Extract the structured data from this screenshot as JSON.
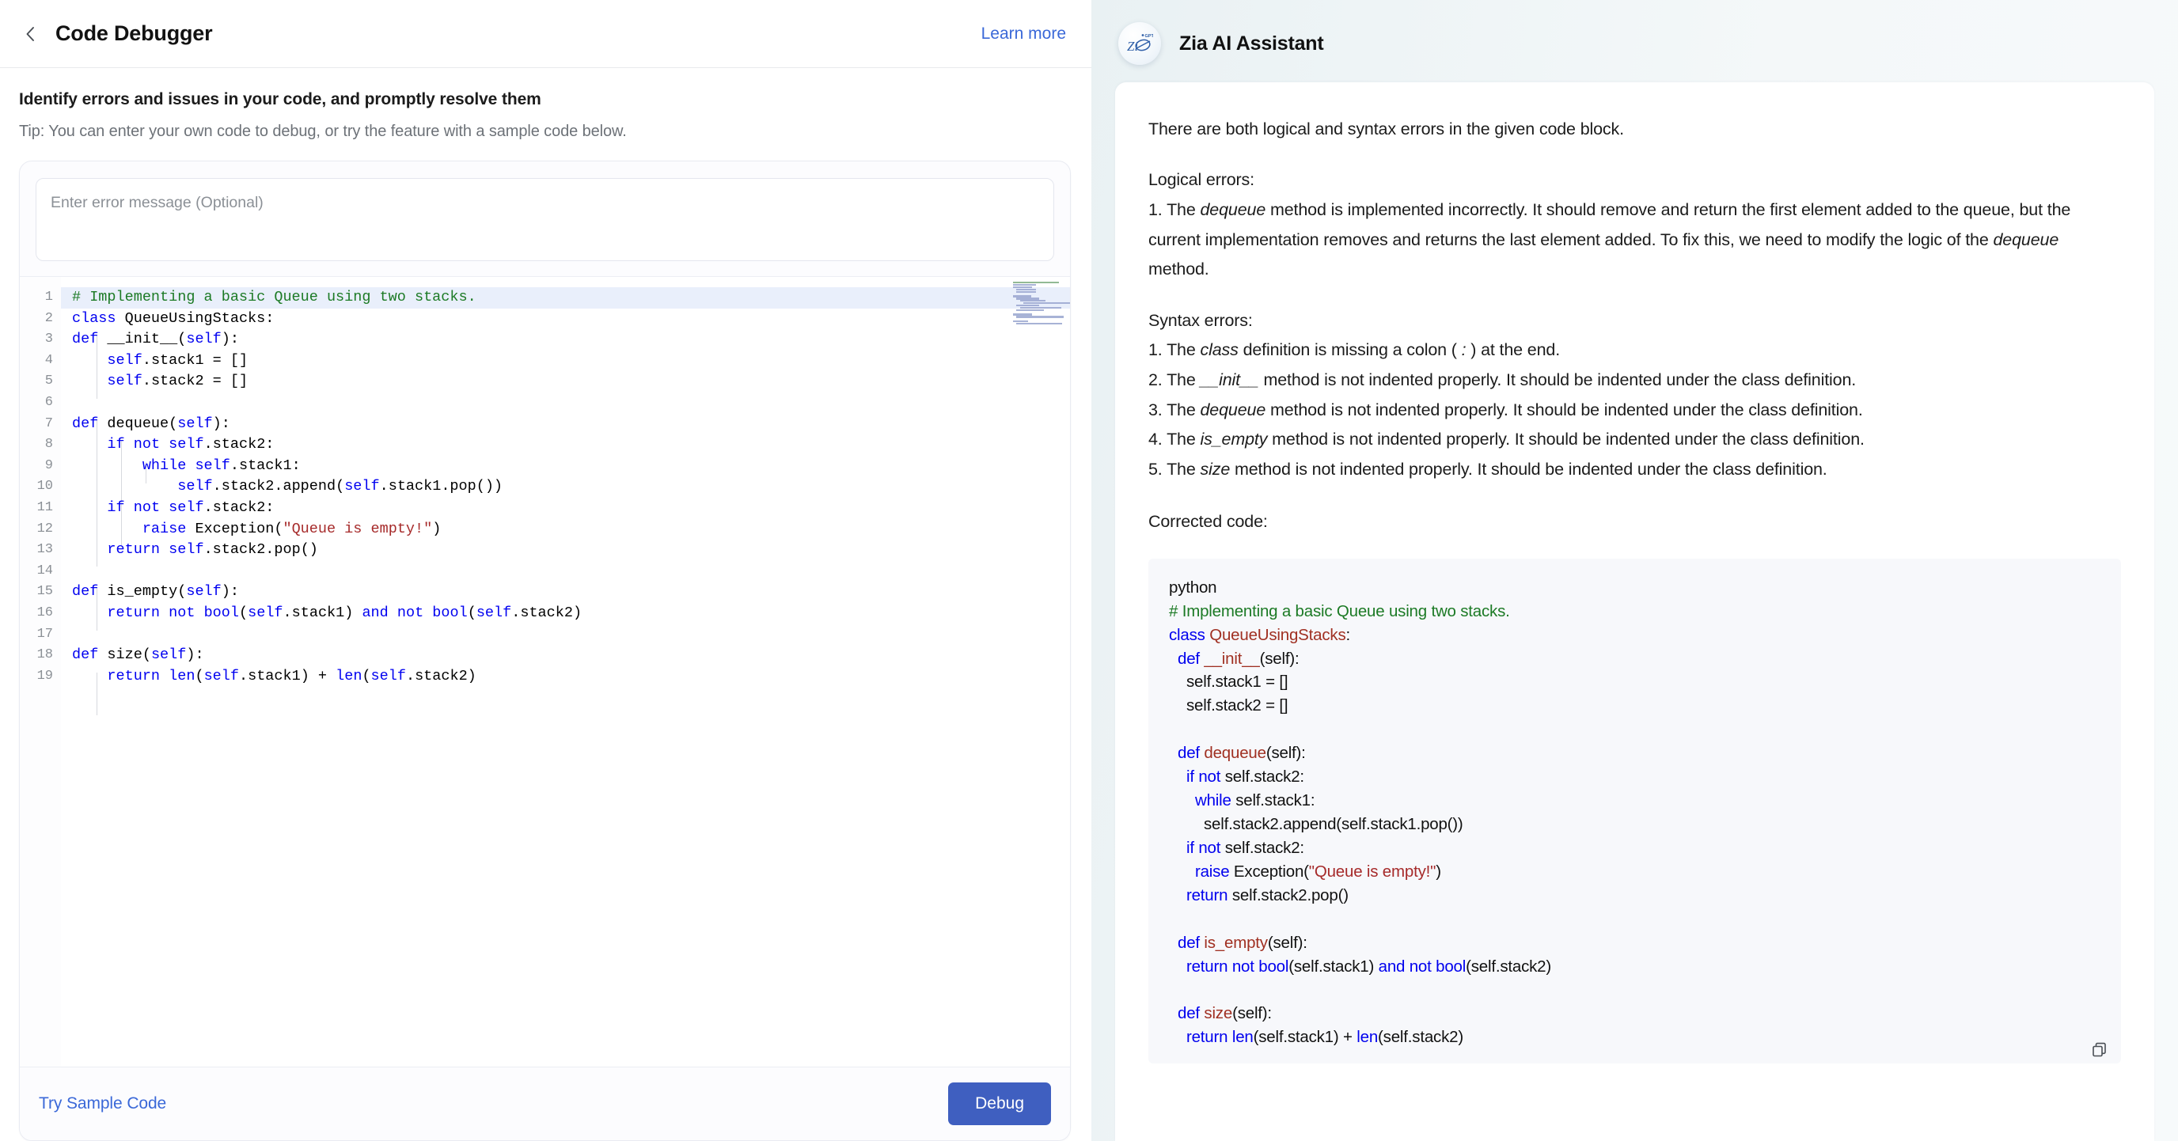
{
  "header": {
    "back_icon": "chevron-left-icon",
    "title": "Code Debugger",
    "learn_more": "Learn more"
  },
  "intro": {
    "title": "Identify errors and issues in your code, and promptly resolve them",
    "tip": "Tip: You can enter your own code to debug, or try the feature with a sample code below."
  },
  "error_input": {
    "placeholder": "Enter error message (Optional)",
    "value": ""
  },
  "footer": {
    "try_sample": "Try Sample Code",
    "debug": "Debug"
  },
  "colors": {
    "accent_blue": "#3a68d8",
    "debug_button": "#3f5fc0",
    "comment_green": "#1c7a25",
    "keyword_blue": "#0000f0",
    "string_red": "#a62a2a",
    "identifier_red": "#a03022",
    "highlight_line": "#e9effb"
  },
  "editor": {
    "line_numbers": [
      1,
      2,
      3,
      4,
      5,
      6,
      7,
      8,
      9,
      10,
      11,
      12,
      13,
      14,
      15,
      16,
      17,
      18,
      19
    ],
    "highlighted_line": 1,
    "lines": [
      {
        "n": 1,
        "text": "# Implementing a basic Queue using two stacks."
      },
      {
        "n": 2,
        "text": "class QueueUsingStacks:"
      },
      {
        "n": 3,
        "text": "def __init__(self):"
      },
      {
        "n": 4,
        "text": "    self.stack1 = []"
      },
      {
        "n": 5,
        "text": "    self.stack2 = []"
      },
      {
        "n": 6,
        "text": ""
      },
      {
        "n": 7,
        "text": "def dequeue(self):"
      },
      {
        "n": 8,
        "text": "    if not self.stack2:"
      },
      {
        "n": 9,
        "text": "        while self.stack1:"
      },
      {
        "n": 10,
        "text": "            self.stack2.append(self.stack1.pop())"
      },
      {
        "n": 11,
        "text": "    if not self.stack2:"
      },
      {
        "n": 12,
        "text": "        raise Exception(\"Queue is empty!\")"
      },
      {
        "n": 13,
        "text": "    return self.stack2.pop()"
      },
      {
        "n": 14,
        "text": ""
      },
      {
        "n": 15,
        "text": "def is_empty(self):"
      },
      {
        "n": 16,
        "text": "    return not bool(self.stack1) and not bool(self.stack2)"
      },
      {
        "n": 17,
        "text": ""
      },
      {
        "n": 18,
        "text": "def size(self):"
      },
      {
        "n": 19,
        "text": "    return len(self.stack1) + len(self.stack2)"
      }
    ]
  },
  "assistant": {
    "logo_icon": "zia-gpt-logo-icon",
    "title": "Zia AI Assistant",
    "intro": "There are both logical and syntax errors in the given code block.",
    "logical_heading": "Logical errors:",
    "logical_items": [
      "1. The `dequeue` method is implemented incorrectly. It should remove and return the first element added to the queue, but the current implementation removes and returns the last element added. To fix this, we need to modify the logic of the `dequeue` method."
    ],
    "syntax_heading": "Syntax errors:",
    "syntax_items": [
      "1. The `class` definition is missing a colon (`:`) at the end.",
      "2. The `__init__` method is not indented properly. It should be indented under the class definition.",
      "3. The `dequeue` method is not indented properly. It should be indented under the class definition.",
      "4. The `is_empty` method is not indented properly. It should be indented under the class definition.",
      "5. The `size` method is not indented properly. It should be indented under the class definition."
    ],
    "corrected_heading": "Corrected code:",
    "corrected_code_lang": "python",
    "corrected_code_lines": [
      "python",
      "# Implementing a basic Queue using two stacks.",
      "class QueueUsingStacks:",
      "  def __init__(self):",
      "    self.stack1 = []",
      "    self.stack2 = []",
      "",
      "  def dequeue(self):",
      "    if not self.stack2:",
      "      while self.stack1:",
      "        self.stack2.append(self.stack1.pop())",
      "    if not self.stack2:",
      "      raise Exception(\"Queue is empty!\")",
      "    return self.stack2.pop()",
      "",
      "  def is_empty(self):",
      "    return not bool(self.stack1) and not bool(self.stack2)",
      "",
      "  def size(self):",
      "    return len(self.stack1) + len(self.stack2)"
    ],
    "copy_icon": "copy-icon"
  }
}
